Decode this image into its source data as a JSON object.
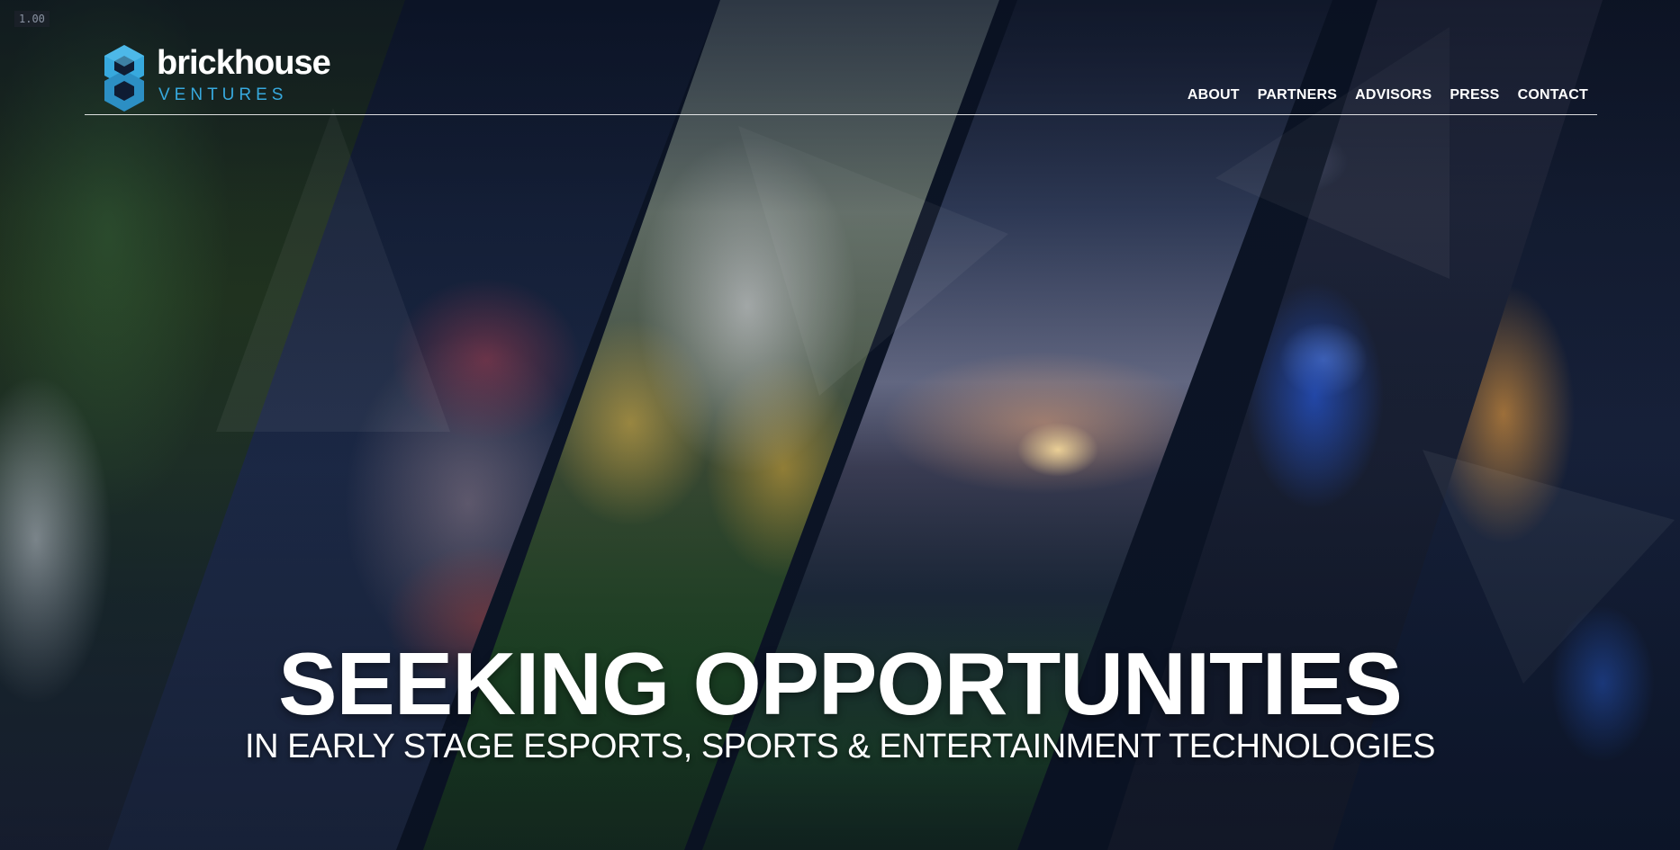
{
  "readout": "1.00",
  "brand": {
    "name": "brickhouse",
    "tagline": "VENTURES",
    "accent_color": "#37a9de"
  },
  "nav": {
    "items": [
      {
        "label": "ABOUT"
      },
      {
        "label": "PARTNERS"
      },
      {
        "label": "ADVISORS"
      },
      {
        "label": "PRESS"
      },
      {
        "label": "CONTACT"
      }
    ]
  },
  "hero": {
    "headline": "SEEKING OPPORTUNITIES",
    "subheadline": "IN EARLY STAGE ESPORTS, SPORTS & ENTERTAINMENT TECHNOLOGIES",
    "panels": [
      {
        "icon": "basketball-photo"
      },
      {
        "icon": "boxing-photo"
      },
      {
        "icon": "football-photo"
      },
      {
        "icon": "stadium-sunset-photo"
      },
      {
        "icon": "esports-photo"
      },
      {
        "icon": "guitar-photo"
      }
    ]
  }
}
